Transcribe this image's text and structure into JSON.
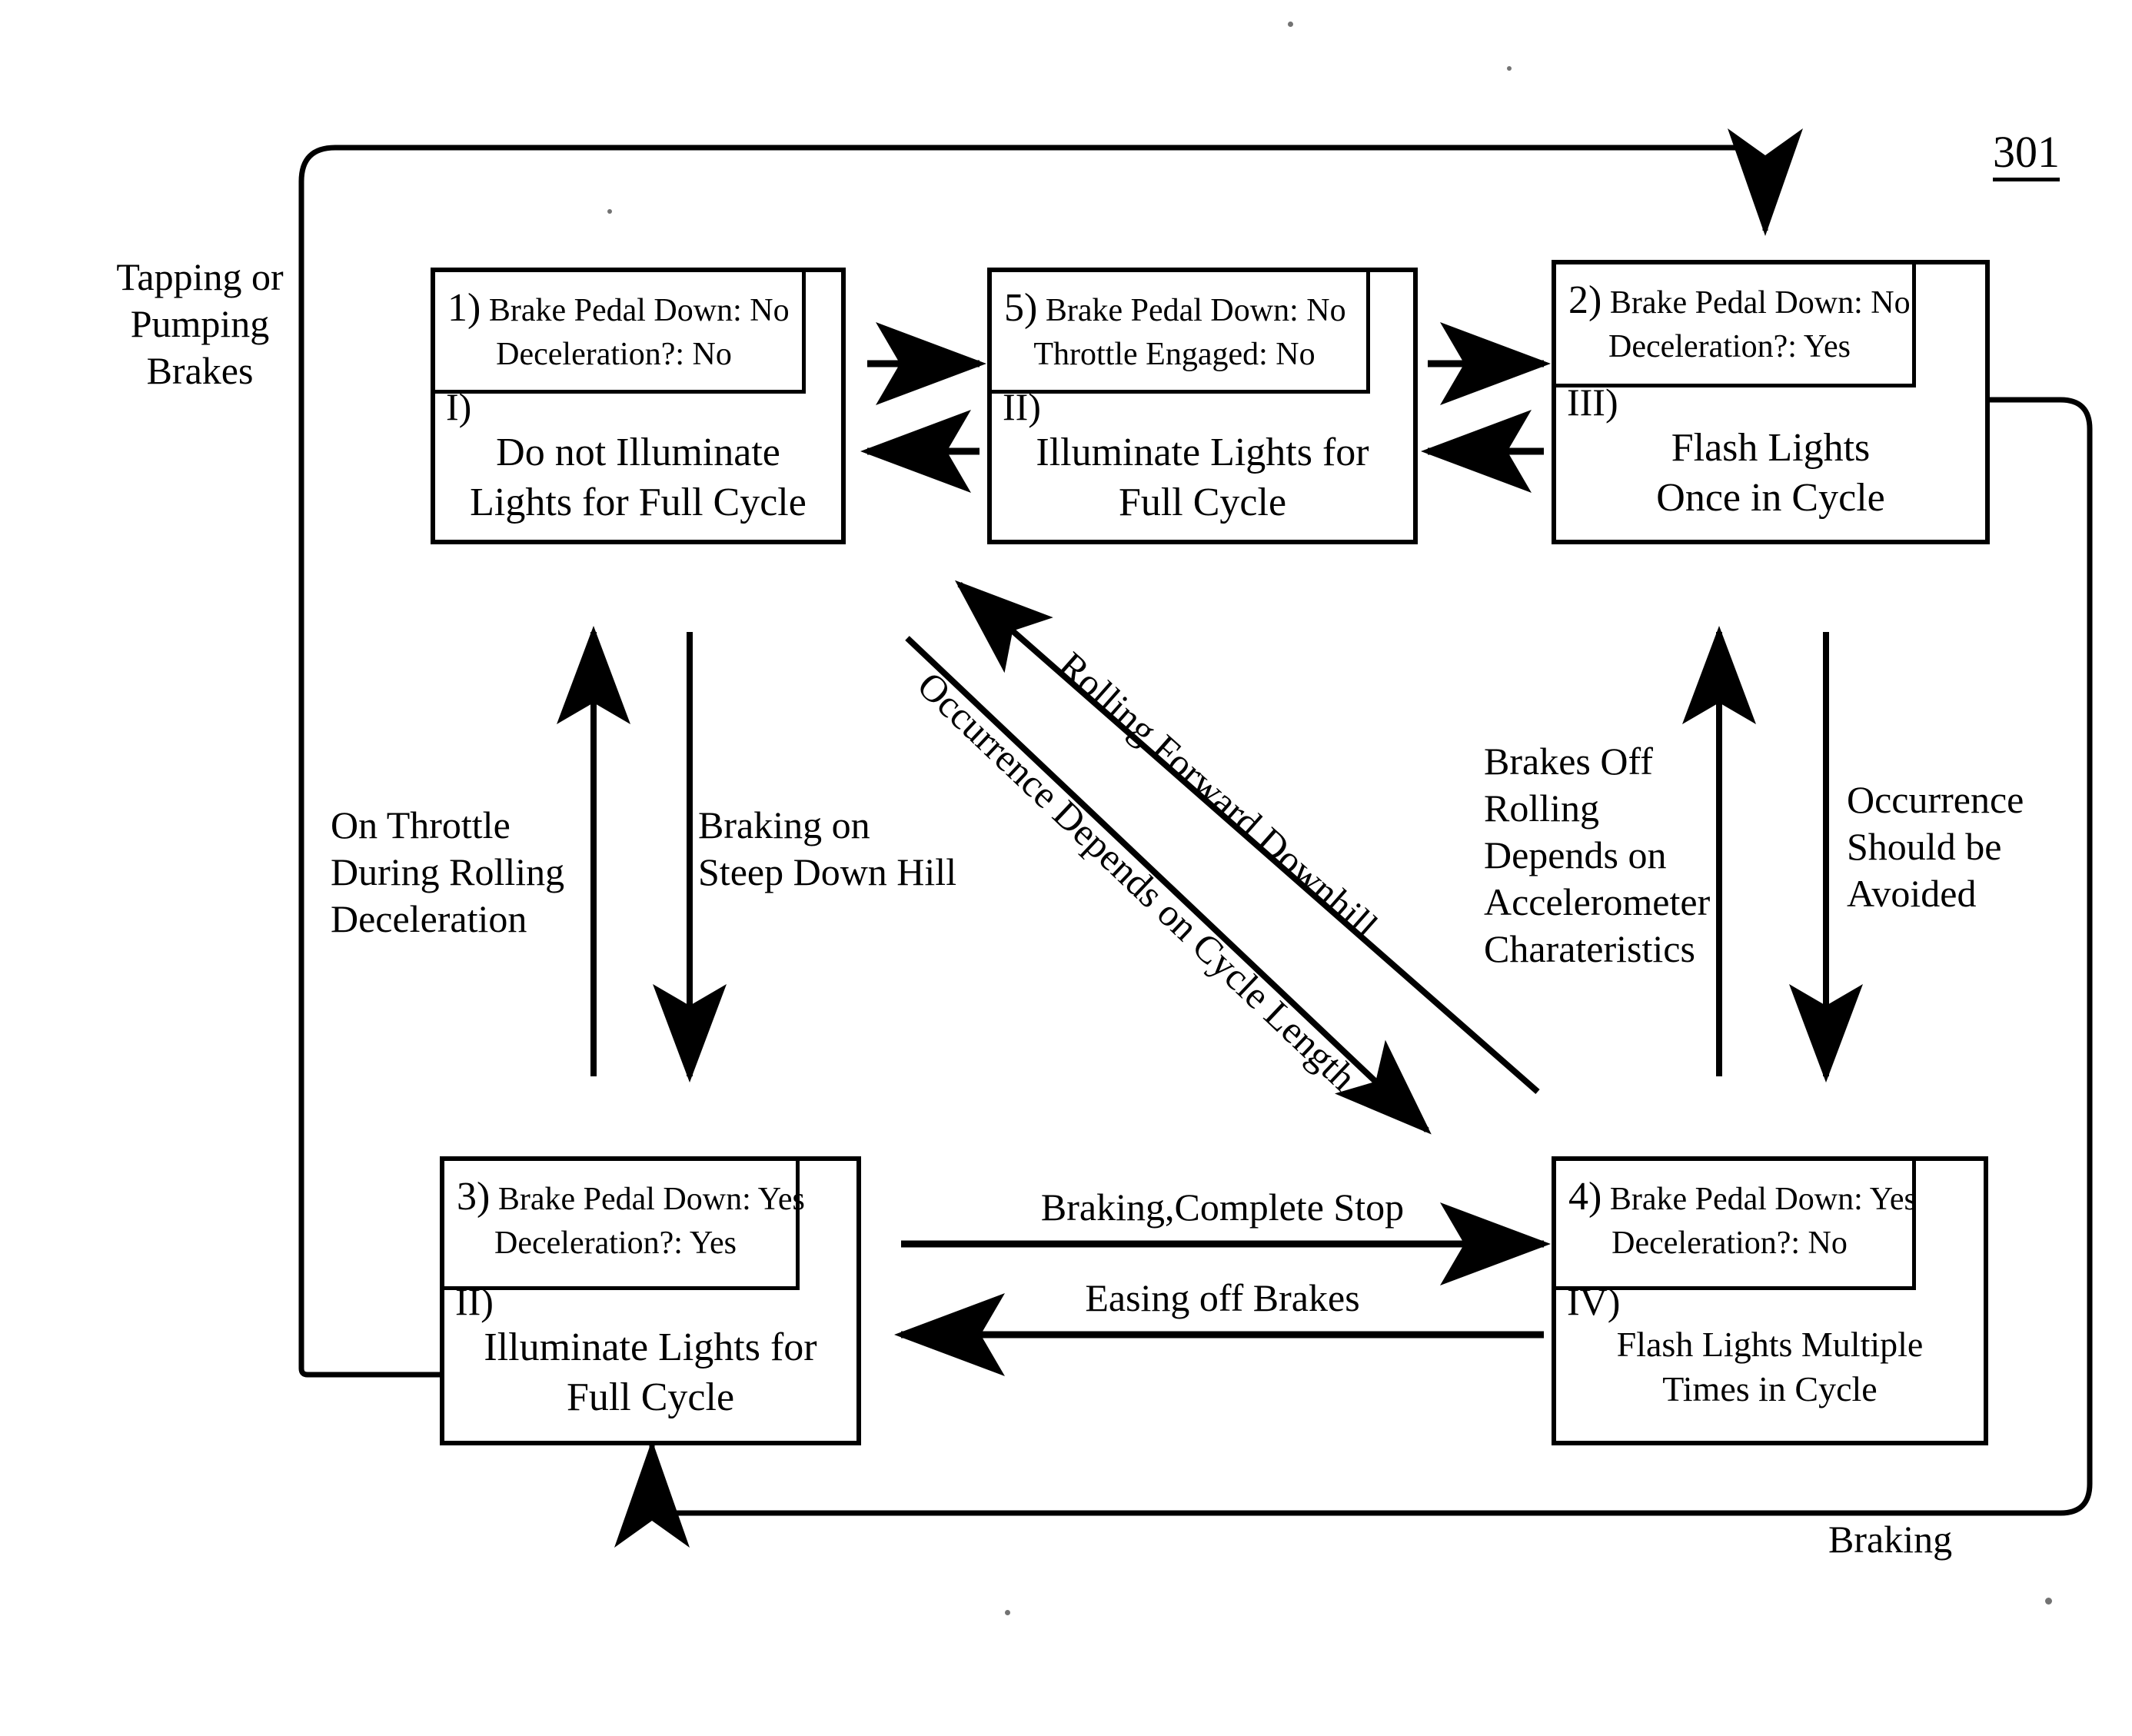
{
  "figure": {
    "number": "301"
  },
  "states": [
    {
      "id": "state-1",
      "number": "1)",
      "condition_line1": "Brake Pedal Down: No",
      "condition_line2": "Deceleration?: No",
      "roman": "I)",
      "action_line1": "Do not Illuminate",
      "action_line2": "Lights for Full Cycle"
    },
    {
      "id": "state-5",
      "number": "5)",
      "condition_line1": "Brake Pedal Down: No",
      "condition_line2": "Throttle Engaged: No",
      "roman": "II)",
      "action_line1": "Illuminate Lights for",
      "action_line2": "Full Cycle"
    },
    {
      "id": "state-2",
      "number": "2)",
      "condition_line1": "Brake Pedal Down: No",
      "condition_line2": "Deceleration?: Yes",
      "roman": "III)",
      "action_line1": "Flash Lights",
      "action_line2": "Once in Cycle"
    },
    {
      "id": "state-3",
      "number": "3)",
      "condition_line1": "Brake Pedal Down: Yes",
      "condition_line2": "Deceleration?: Yes",
      "roman": "II)",
      "action_line1": "Illuminate Lights for",
      "action_line2": "Full Cycle"
    },
    {
      "id": "state-4",
      "number": "4)",
      "condition_line1": "Brake Pedal Down: Yes",
      "condition_line2": "Deceleration?: No",
      "roman": "IV)",
      "action_line1": "Flash Lights Multiple",
      "action_line2": "Times in Cycle"
    }
  ],
  "transition_labels": {
    "tapping_or_pumping_brakes": "Tapping or\nPumping\nBrakes",
    "on_throttle_during_rolling_deceleration": "On Throttle\nDuring Rolling\nDeceleration",
    "braking_on_steep_down_hill": "Braking on\nSteep Down Hill",
    "rolling_forward_downhill": "Rolling Forward Downhill",
    "occurrence_depends_on_cycle_length": "Occurrence Depends on Cycle Length",
    "brakes_off_rolling_depends_on_accelerometer": "Brakes Off\nRolling\nDepends on\nAccelerometer\nCharateristics",
    "occurrence_should_be_avoided": "Occurrence\nShould be\nAvoided",
    "braking_complete_stop": "Braking,Complete Stop",
    "easing_off_brakes": "Easing off Brakes",
    "braking": "Braking"
  },
  "colors": {
    "ink": "#000000",
    "paper": "#ffffff"
  }
}
